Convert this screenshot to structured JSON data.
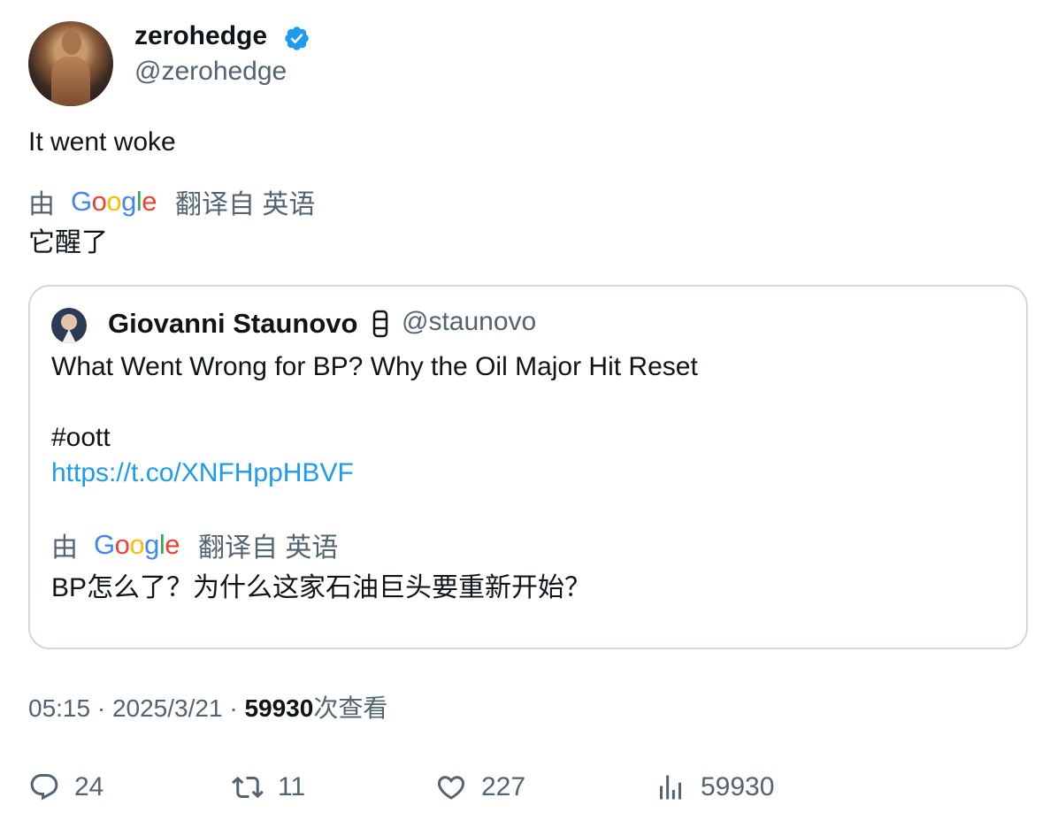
{
  "author": {
    "name": "zerohedge",
    "handle": "@zerohedge"
  },
  "tweet": {
    "text": "It went woke"
  },
  "translation": {
    "by": "由",
    "from": "翻译自 英语",
    "text": "它醒了",
    "logo_text": "Google"
  },
  "quote": {
    "name": "Giovanni Staunovo",
    "handle": "@staunovo",
    "line1": "What Went Wrong for BP? Why the Oil Major Hit Reset",
    "hashtag": "#oott",
    "link": "https://t.co/XNFHppHBVF",
    "translation": {
      "by": "由",
      "from": "翻译自 英语",
      "text": "BP怎么了？为什么这家石油巨头要重新开始？",
      "logo_text": "Google"
    }
  },
  "meta": {
    "time": "05:15",
    "date": "2025/3/21",
    "views": "59930",
    "views_label": "次查看",
    "sep": "·"
  },
  "actions": {
    "replies": "24",
    "retweets": "11",
    "likes": "227",
    "views": "59930"
  },
  "icons": [
    "verified-badge-icon",
    "oil-drum-icon",
    "reply-icon",
    "retweet-icon",
    "like-icon",
    "views-icon",
    "google-logo-icon"
  ],
  "colors": {
    "verified": "#1d9bf0",
    "link": "#1d9bf0",
    "secondary": "#536471",
    "border": "#cfd9de"
  }
}
